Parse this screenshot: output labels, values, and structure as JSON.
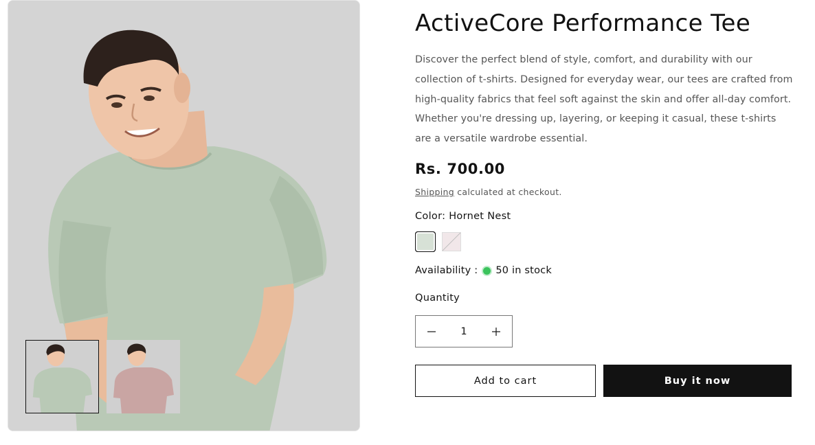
{
  "product": {
    "title": "ActiveCore Performance Tee",
    "description": "Discover the perfect blend of style, comfort, and durability with our collection of t-shirts. Designed for everyday wear, our tees are crafted from high-quality fabrics that feel soft against the skin and offer all-day comfort. Whether you're dressing up, layering, or keeping it casual, these t-shirts are a versatile wardrobe essential.",
    "price": "Rs. 700.00",
    "shipping_link": "Shipping",
    "shipping_suffix": " calculated at checkout."
  },
  "variants": {
    "color_label": "Color:",
    "color_selected": "Hornet Nest",
    "swatches": [
      {
        "name": "Hornet Nest",
        "color": "#d7e1d6",
        "selected": true,
        "available": true
      },
      {
        "name": "Pink",
        "color": "#f1e7e9",
        "selected": false,
        "available": false
      }
    ]
  },
  "availability": {
    "label": "Availability :",
    "status": "50 in stock",
    "dot_color": "#3bc35c"
  },
  "quantity": {
    "label": "Quantity",
    "value": "1",
    "decrease_icon": "minus-icon",
    "increase_icon": "plus-icon"
  },
  "actions": {
    "add_to_cart": "Add to cart",
    "buy_now": "Buy it now"
  },
  "media": {
    "main_image": "man-in-sage-green-tshirt",
    "thumbnails": [
      {
        "name": "sage-green-tshirt-thumb",
        "active": true
      },
      {
        "name": "pink-tshirt-thumb",
        "active": false
      }
    ]
  },
  "colors": {
    "text": "#121212",
    "muted": "#555555",
    "button_dark": "#121212",
    "media_bg": "#d4d4d4"
  }
}
